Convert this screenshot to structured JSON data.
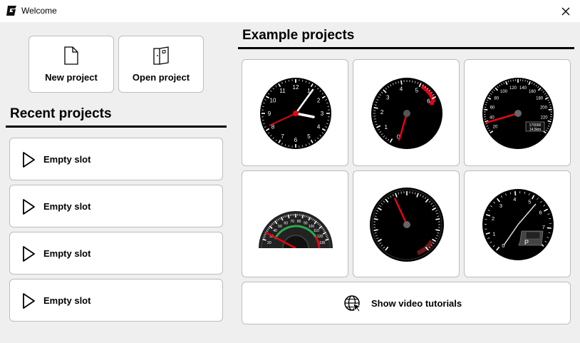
{
  "window": {
    "title": "Welcome",
    "logo_letter": "G"
  },
  "actions": {
    "new_project": "New project",
    "open_project": "Open project"
  },
  "recent": {
    "title": "Recent projects",
    "slots": [
      "Empty slot",
      "Empty slot",
      "Empty slot",
      "Empty slot"
    ]
  },
  "examples": {
    "title": "Example projects",
    "items": [
      {
        "kind": "clock",
        "labels": [
          "12",
          "1",
          "2",
          "3",
          "4",
          "5",
          "6",
          "7",
          "8",
          "9",
          "10",
          "11"
        ]
      },
      {
        "kind": "tachometer",
        "labels": [
          "0",
          "1",
          "2",
          "3",
          "4",
          "5",
          "6"
        ]
      },
      {
        "kind": "speedometer",
        "labels": [
          "20",
          "40",
          "60",
          "80",
          "100",
          "120",
          "140",
          "160",
          "180",
          "200",
          "220",
          "240"
        ],
        "odometer": "170000",
        "trip": "14.5km"
      },
      {
        "kind": "speedometer-half",
        "labels": [
          "20",
          "30",
          "40",
          "50",
          "60",
          "70",
          "80",
          "90",
          "100",
          "110",
          "120",
          "130"
        ]
      },
      {
        "kind": "tachometer-dark"
      },
      {
        "kind": "tachometer-gear",
        "labels": [
          "0",
          "1",
          "2",
          "3",
          "4",
          "5",
          "6",
          "7",
          "8"
        ],
        "gear": "P"
      }
    ]
  },
  "tutorials": {
    "label": "Show video tutorials"
  },
  "colors": {
    "window_bg": "#efefef",
    "card_bg": "#ffffff",
    "card_border": "#bdbdbd",
    "gauge_face": "#000000",
    "needle_red": "#e30613"
  },
  "icons": {
    "new_project": "file-icon",
    "open_project": "folder-open-icon",
    "slot": "play-icon",
    "tutorials": "globe-cursor-icon",
    "close": "close-icon"
  }
}
